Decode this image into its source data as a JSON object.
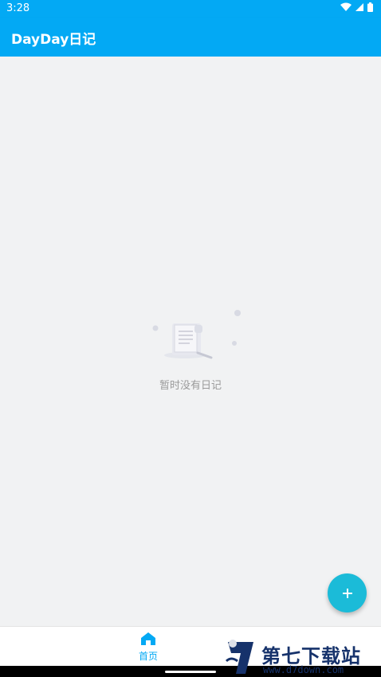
{
  "status_bar": {
    "time": "3:28",
    "icons": [
      "wifi-icon",
      "signal-icon",
      "battery-icon"
    ]
  },
  "app_bar": {
    "title": "DayDay日记",
    "color": "#03a9f4"
  },
  "content": {
    "empty_text": "暂时没有日记"
  },
  "fab": {
    "label": "+",
    "color": "#1bbbd8"
  },
  "bottom_nav": {
    "items": [
      {
        "label": "首页",
        "icon": "home-icon",
        "active": true,
        "active_color": "#03a9f4"
      }
    ]
  },
  "watermark": {
    "title": "第七下载站",
    "url": "www.d7down.com"
  }
}
